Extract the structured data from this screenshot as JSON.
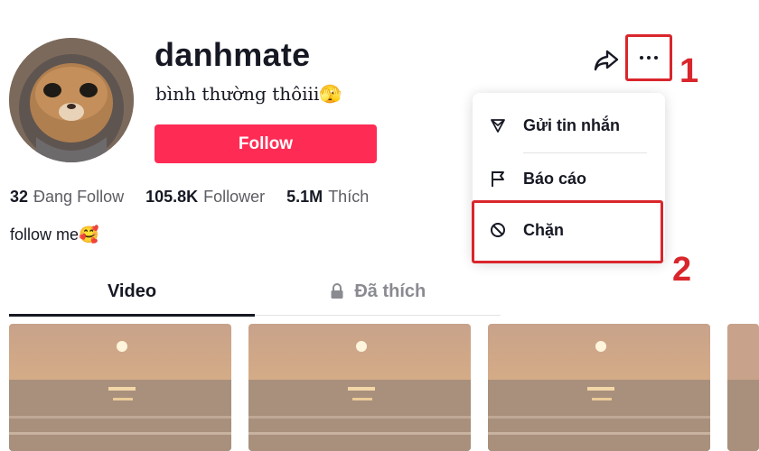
{
  "profile": {
    "username": "danhmate",
    "nickname": "bình thường thôiii🫣",
    "follow_label": "Follow",
    "bio": "follow me🥰"
  },
  "stats": [
    {
      "value": "32",
      "label": "Đang Follow"
    },
    {
      "value": "105.8K",
      "label": "Follower"
    },
    {
      "value": "5.1M",
      "label": "Thích"
    }
  ],
  "tabs": {
    "video": "Video",
    "liked": "Đã thích"
  },
  "menu": {
    "message": "Gửi tin nhắn",
    "report": "Báo cáo",
    "block": "Chặn"
  },
  "annotations": {
    "step1": "1",
    "step2": "2"
  },
  "icons": {
    "share": "share-icon",
    "more": "more-icon",
    "message": "send-icon",
    "report": "flag-icon",
    "block": "block-icon",
    "lock": "lock-icon"
  },
  "colors": {
    "accent": "#fe2c55",
    "annotation": "#d9262c",
    "text": "#161823",
    "muted": "#5c5c63"
  }
}
